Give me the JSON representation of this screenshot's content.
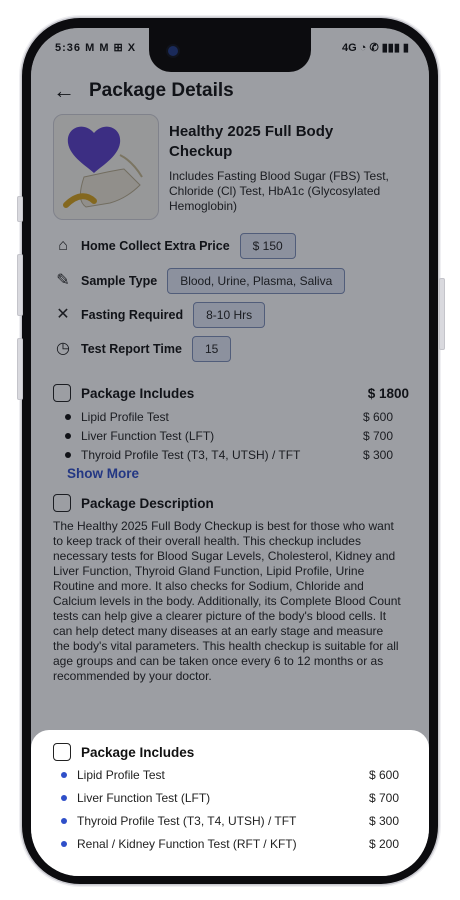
{
  "status_bar": {
    "time": "5:36",
    "left_icons": "M M ⊞ X",
    "network": "4G"
  },
  "header": {
    "title": "Package Details"
  },
  "package": {
    "name": "Healthy 2025 Full Body Checkup",
    "subtitle": "Includes Fasting Blood Sugar (FBS) Test, Chloride (Cl) Test, HbA1c (Glycosylated Hemoglobin)"
  },
  "info": {
    "home_collect": {
      "label": "Home Collect Extra Price",
      "value": "$ 150"
    },
    "sample_type": {
      "label": "Sample Type",
      "value": "Blood, Urine, Plasma, Saliva"
    },
    "fasting": {
      "label": "Fasting Required",
      "value": "8-10 Hrs"
    },
    "report_time": {
      "label": "Test Report Time",
      "value": "15"
    }
  },
  "includes": {
    "label": "Package Includes",
    "total": "$ 1800",
    "items": [
      {
        "name": "Lipid Profile Test",
        "price": "$ 600"
      },
      {
        "name": "Liver Function Test (LFT)",
        "price": "$ 700"
      },
      {
        "name": "Thyroid Profile Test (T3, T4, UTSH) / TFT",
        "price": "$ 300"
      }
    ],
    "show_more": "Show More"
  },
  "description": {
    "label": "Package Description",
    "text": "The Healthy 2025 Full Body Checkup is best for those who want to keep track of their overall health. This checkup includes necessary tests for Blood Sugar Levels, Cholesterol, Kidney and Liver Function, Thyroid Gland Function, Lipid Profile, Urine Routine and more. It also checks for Sodium, Chloride and Calcium levels in the body. Additionally, its Complete Blood Count tests can help give a clearer picture of the body's blood cells. It can help detect many diseases at an early stage and measure the body's vital parameters. This health checkup is suitable for all age groups and can be taken once every 6 to 12 months or as recommended by your doctor."
  },
  "sheet": {
    "label": "Package Includes",
    "items": [
      {
        "name": "Lipid Profile Test",
        "price": "$ 600"
      },
      {
        "name": "Liver Function Test (LFT)",
        "price": "$ 700"
      },
      {
        "name": "Thyroid Profile Test (T3, T4, UTSH) / TFT",
        "price": "$ 300"
      },
      {
        "name": "Renal / Kidney Function Test (RFT / KFT)",
        "price": "$ 200"
      }
    ]
  },
  "colors": {
    "accent": "#2f4fc9",
    "pill_bg": "#e4e9f6",
    "pill_border": "#7f8fb8"
  }
}
